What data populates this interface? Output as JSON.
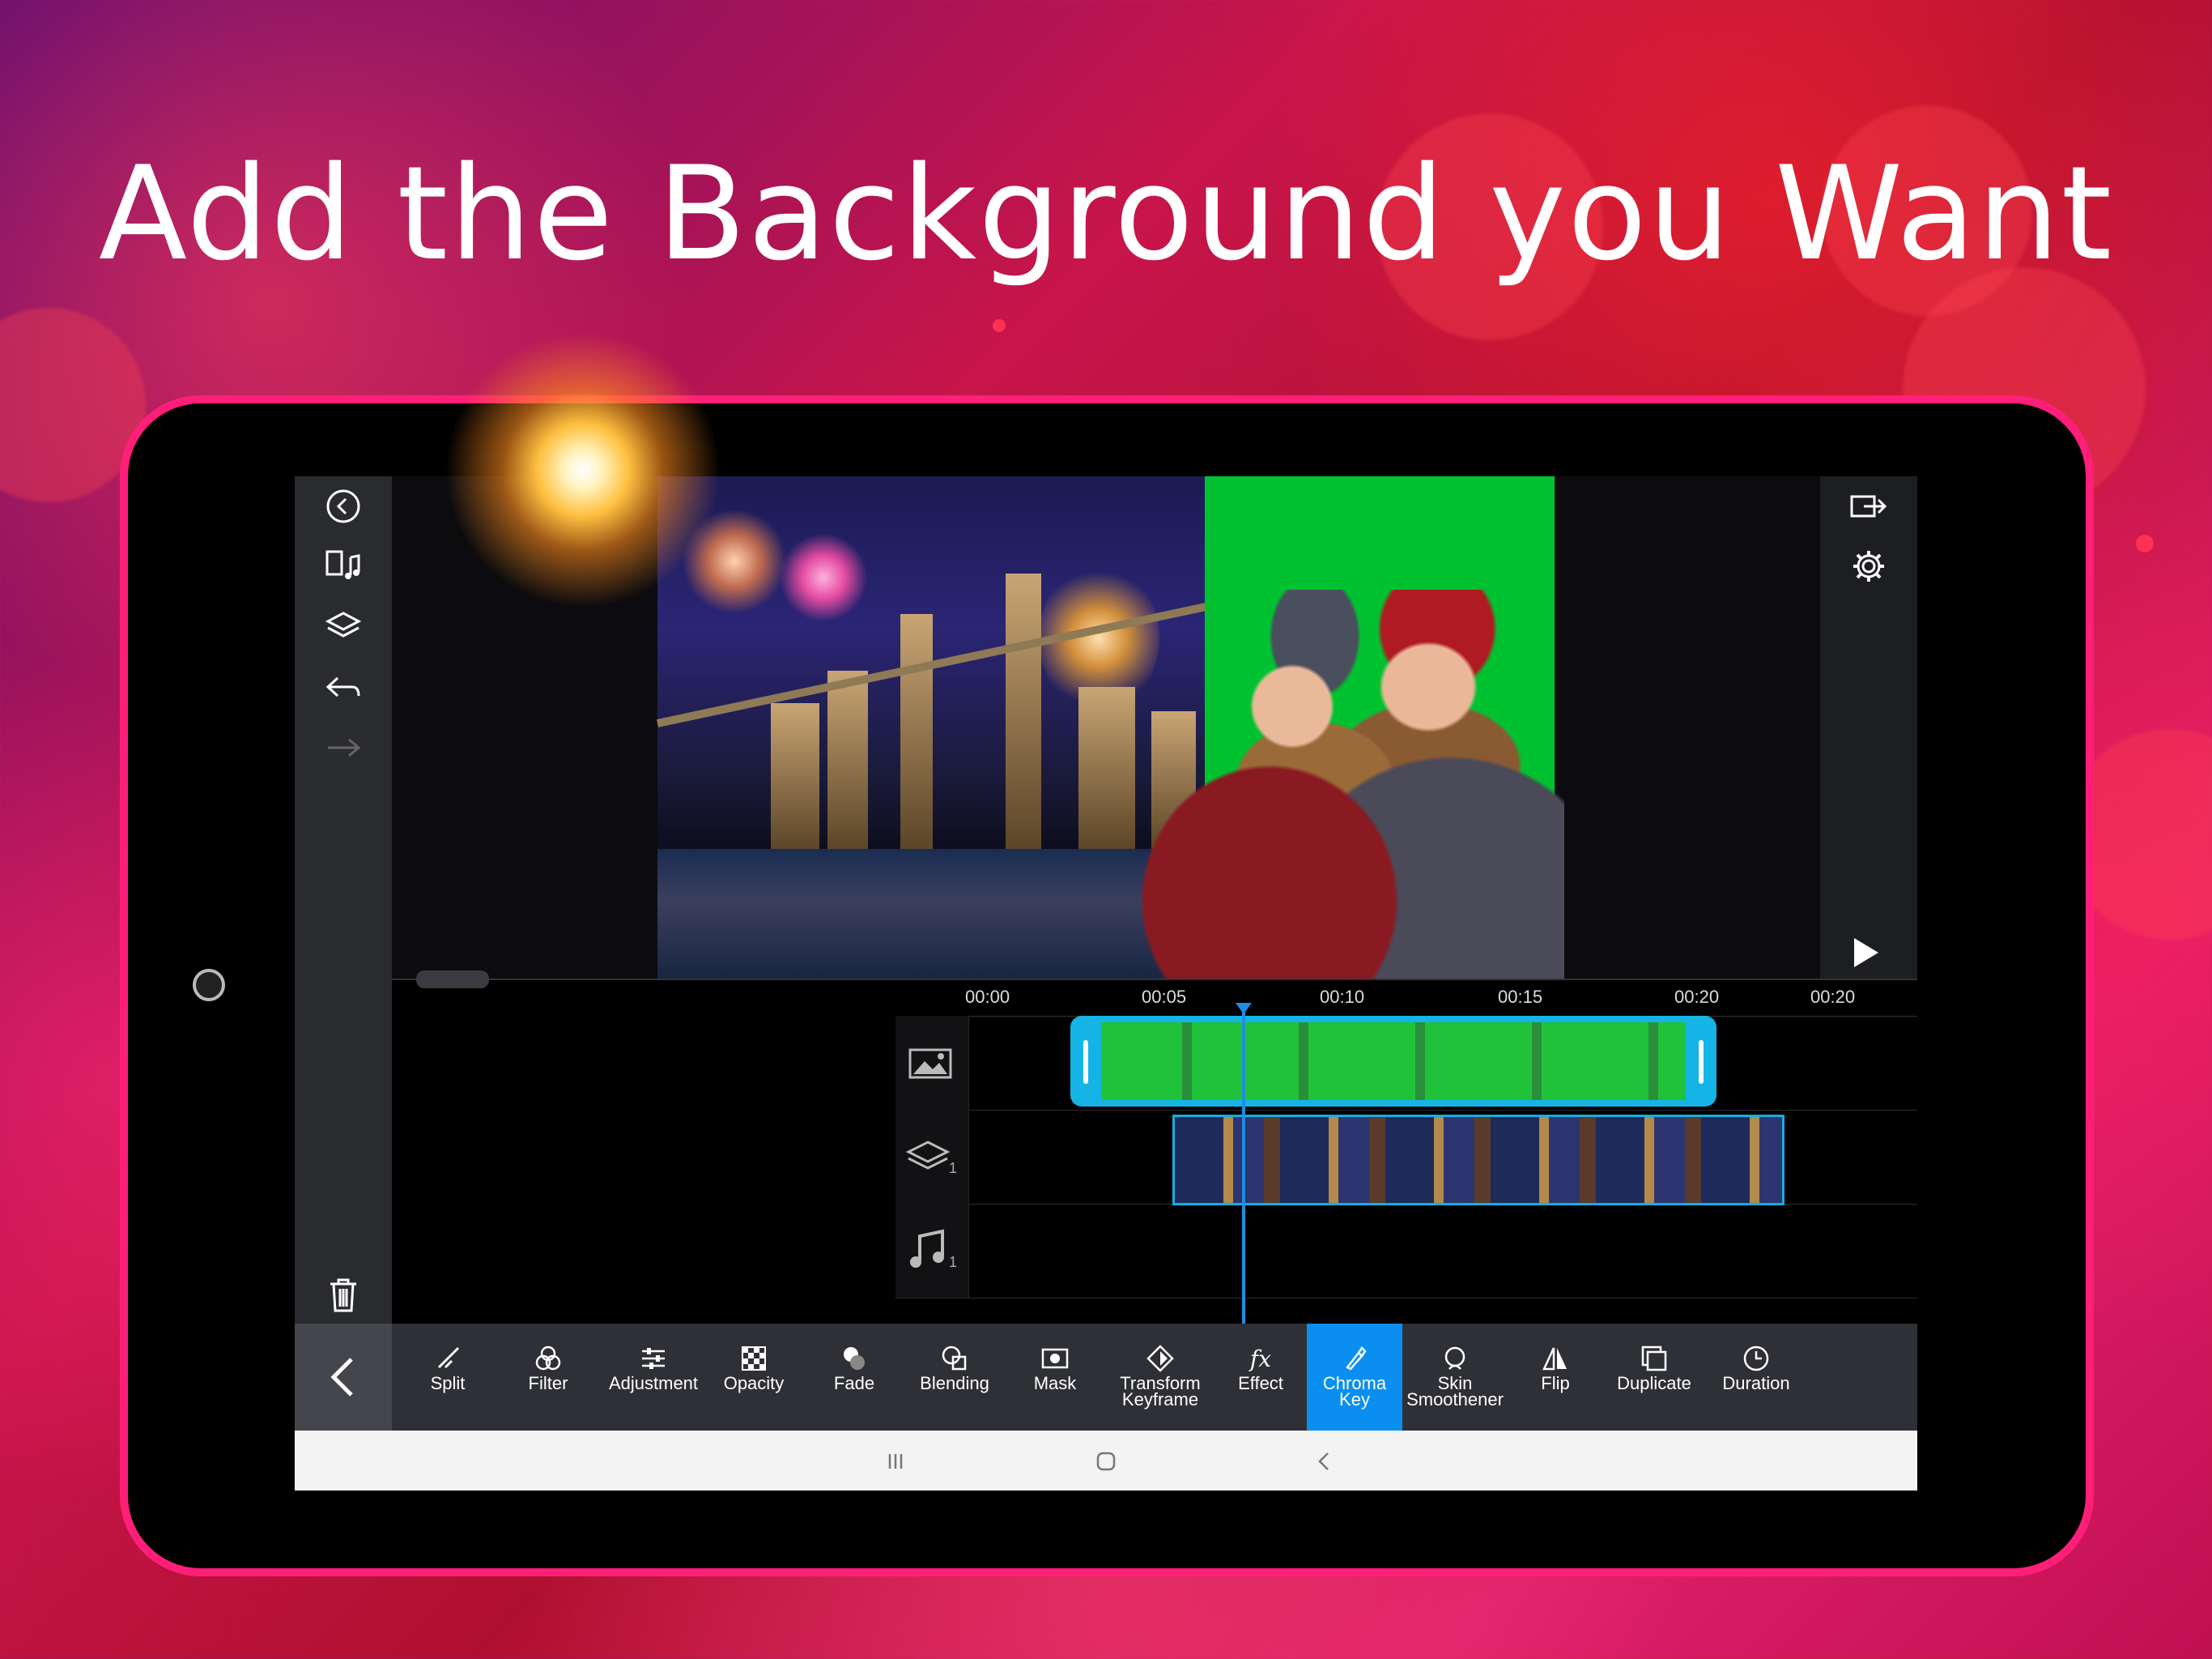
{
  "headline": "Add the Background you Want",
  "colors": {
    "accent": "#0a8ff0",
    "clip_border": "#14b4e6",
    "green_screen": "#00c230",
    "frame": "#ff1e78"
  },
  "left_toolbar": {
    "icons": [
      "back-circle-icon",
      "media-library-icon",
      "layers-icon",
      "undo-icon",
      "redo-icon",
      "trash-icon"
    ]
  },
  "right_toolbar": {
    "icons": [
      "export-icon",
      "settings-icon",
      "play-icon"
    ]
  },
  "timeline": {
    "ticks": [
      "00:00",
      "00:05",
      "00:10",
      "00:15",
      "00:20",
      "00:20"
    ],
    "tracks": [
      {
        "icon": "image-track-icon",
        "count": ""
      },
      {
        "icon": "layer-track-icon",
        "count": "1"
      },
      {
        "icon": "music-track-icon",
        "count": "1"
      }
    ]
  },
  "bottom_toolbar": {
    "tools": [
      {
        "label": "Split",
        "icon": "split-icon"
      },
      {
        "label": "Filter",
        "icon": "filter-icon"
      },
      {
        "label": "Adjustment",
        "icon": "adjustment-icon"
      },
      {
        "label": "Opacity",
        "icon": "opacity-icon"
      },
      {
        "label": "Fade",
        "icon": "fade-icon"
      },
      {
        "label": "Blending",
        "icon": "blending-icon"
      },
      {
        "label": "Mask",
        "icon": "mask-icon"
      },
      {
        "label": "Transform Keyframe",
        "icon": "transform-keyframe-icon"
      },
      {
        "label": "Effect",
        "icon": "effect-icon"
      },
      {
        "label": "Chroma Key",
        "icon": "chroma-key-icon",
        "active": true
      },
      {
        "label": "Skin Smoothener",
        "icon": "skin-smoothener-icon"
      },
      {
        "label": "Flip",
        "icon": "flip-icon"
      },
      {
        "label": "Duplicate",
        "icon": "duplicate-icon"
      },
      {
        "label": "Duration",
        "icon": "duration-icon"
      }
    ]
  },
  "android_nav": {
    "icons": [
      "recents-icon",
      "home-icon",
      "back-icon"
    ]
  }
}
